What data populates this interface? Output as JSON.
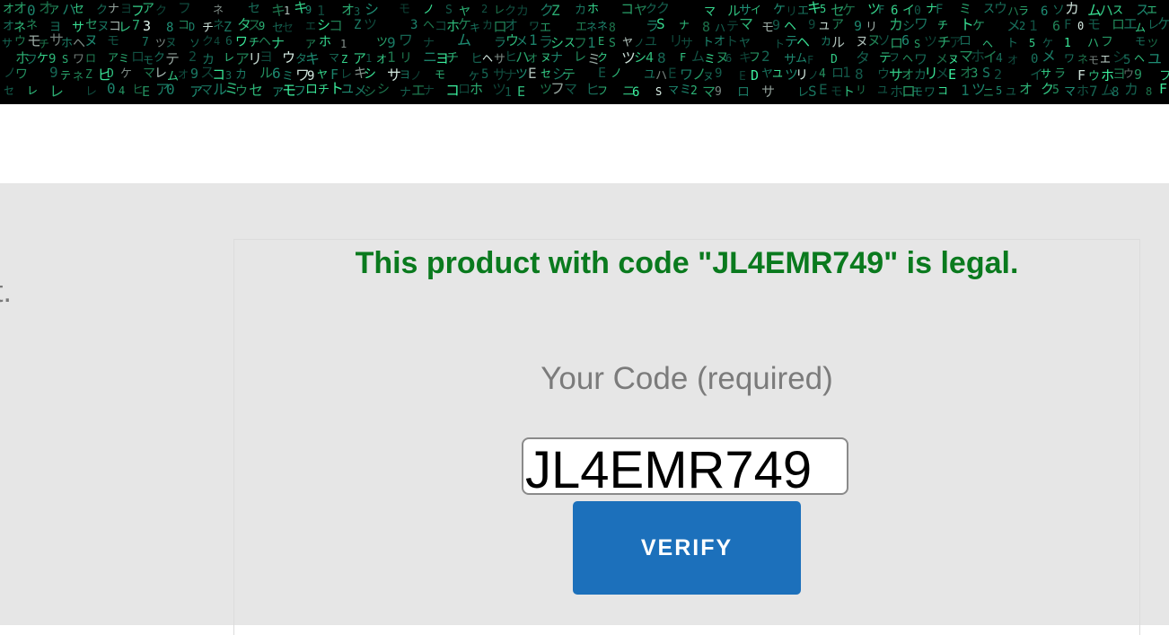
{
  "colors": {
    "matrix_green": "#3df2a0",
    "success_green": "#0a7a1e",
    "button_blue": "#1c70bb",
    "content_bg": "#e6e6e6"
  },
  "main": {
    "left_text_fragment": "t.",
    "status_message": "This product with code \"JL4EMR749\" is legal.",
    "code_label": "Your Code (required)",
    "code_value": "JL4EMR749",
    "verify_label": "VERIFY"
  }
}
